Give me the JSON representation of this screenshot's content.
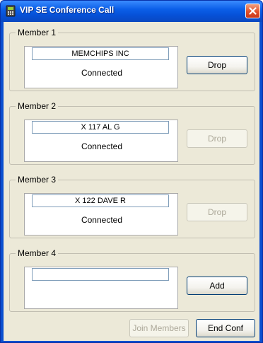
{
  "window": {
    "title": "VIP SE Conference Call"
  },
  "members": [
    {
      "legend": "Member 1",
      "name": "MEMCHIPS INC",
      "status": "Connected",
      "button": "Drop",
      "button_enabled": true
    },
    {
      "legend": "Member 2",
      "name": "X 117 AL G",
      "status": "Connected",
      "button": "Drop",
      "button_enabled": false
    },
    {
      "legend": "Member 3",
      "name": "X 122 DAVE R",
      "status": "Connected",
      "button": "Drop",
      "button_enabled": false
    },
    {
      "legend": "Member 4",
      "name": "",
      "status": "",
      "button": "Add",
      "button_enabled": true
    }
  ],
  "footer": {
    "join_label": "Join Members",
    "join_enabled": false,
    "end_label": "End Conf"
  },
  "icons": {
    "app": "phone-icon",
    "close": "close-icon"
  },
  "colors": {
    "titlebar": "#0b5fe8",
    "close": "#e2512a",
    "client": "#ece9d8",
    "disabled_text": "#aca899"
  }
}
